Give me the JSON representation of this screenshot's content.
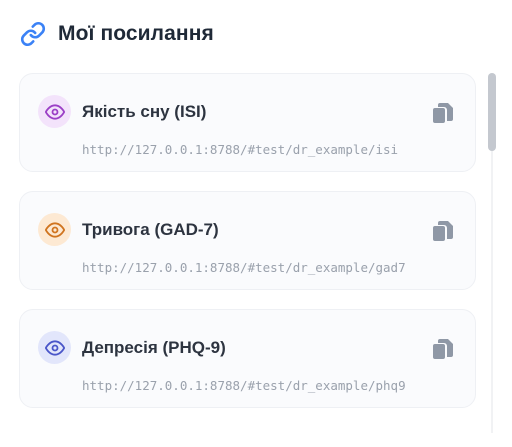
{
  "header": {
    "title": "Мої посилання",
    "icon": "link-icon"
  },
  "links": [
    {
      "title": "Якість сну (ISI)",
      "url": "http://127.0.0.1:8788/#test/dr_example/isi",
      "accent": "#9b3fc6",
      "badge_bg": "#f3e3fb"
    },
    {
      "title": "Тривога (GAD-7)",
      "url": "http://127.0.0.1:8788/#test/dr_example/gad7",
      "accent": "#d0741f",
      "badge_bg": "#fde9d3"
    },
    {
      "title": "Депресія (PHQ-9)",
      "url": "http://127.0.0.1:8788/#test/dr_example/phq9",
      "accent": "#4a56c9",
      "badge_bg": "#e2e6fb"
    }
  ],
  "colors": {
    "link_icon": "#3b82f6",
    "copy_icon": "#8f98a6"
  }
}
